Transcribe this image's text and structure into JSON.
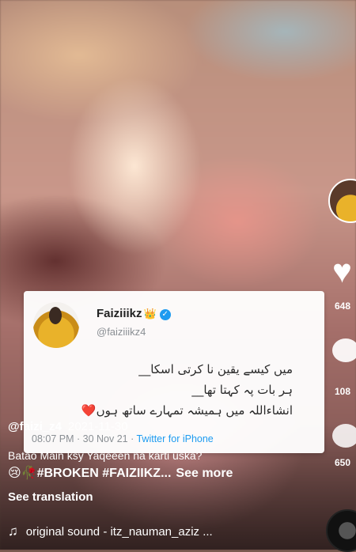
{
  "post": {
    "author": "@faizi_z4",
    "date": "2021-11-30",
    "caption": "Batao Main ksy Yaqeeen na karti uska?",
    "hashtags": "😢🥀#BROKEN #FAIZIIKZ...",
    "see_more": "See more",
    "see_translation": "See translation",
    "sound": "original sound - itz_nauman_aziz ..."
  },
  "tweet": {
    "name": "Faiziiikz",
    "handle": "@faiziiikz4",
    "lines": [
      "میں کیسے یقین نا کرتی اسکا__",
      "ہر بات پہ کہتا تھا__",
      "انشاءاللہ میں ہمیشہ تمہارے ساتھ ہوں❤️"
    ],
    "time": "08:07 PM · 30 Nov 21 · ",
    "source": "Twitter for iPhone"
  },
  "actions": {
    "likes": "648",
    "comments": "108",
    "shares": "650"
  },
  "icons": {
    "heart": "heart-icon",
    "comment": "comment-icon",
    "share": "share-icon",
    "music": "music-note-icon",
    "verified": "verified-badge-icon"
  },
  "colors": {
    "verified": "#1d9bf0",
    "tweet_bg": "#ffffff"
  }
}
